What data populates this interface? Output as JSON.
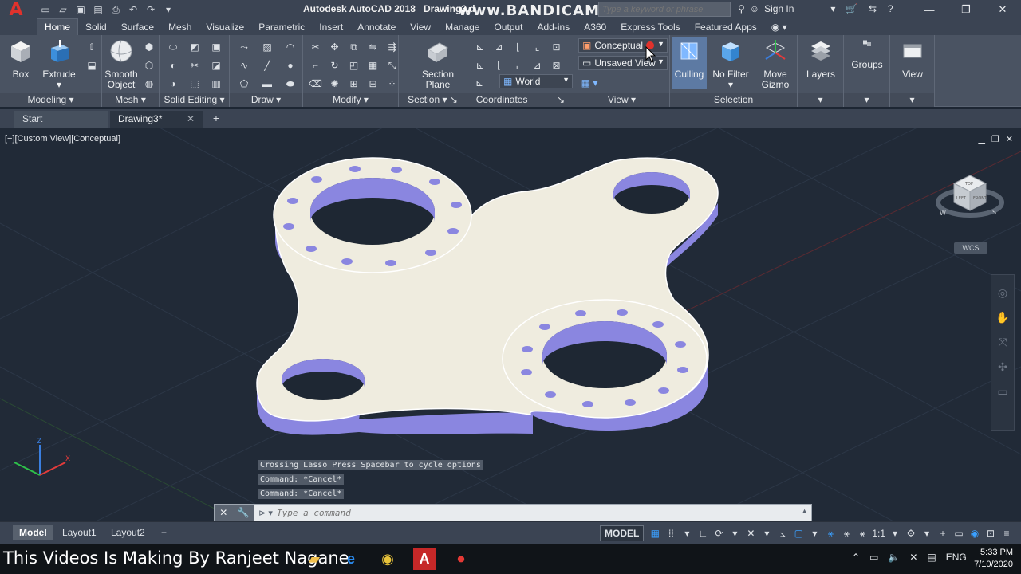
{
  "titlebar": {
    "app_title": "Autodesk AutoCAD 2018",
    "drawing_title": "Drawing3.d",
    "watermark": "www.BANDICAM.com",
    "search_placeholder": "Type a keyword or phrase",
    "sign_in": "Sign In"
  },
  "ribbon_tabs": [
    "Home",
    "Solid",
    "Surface",
    "Mesh",
    "Visualize",
    "Parametric",
    "Insert",
    "Annotate",
    "View",
    "Manage",
    "Output",
    "Add-ins",
    "A360",
    "Express Tools",
    "Featured Apps"
  ],
  "ribbon": {
    "modeling": {
      "title": "Modeling",
      "box": "Box",
      "extrude": "Extrude"
    },
    "mesh": {
      "title": "Mesh",
      "smooth_object": "Smooth Object"
    },
    "solid_editing": {
      "title": "Solid Editing"
    },
    "draw": {
      "title": "Draw"
    },
    "modify": {
      "title": "Modify"
    },
    "section": {
      "title": "Section",
      "section_plane": "Section Plane"
    },
    "coordinates": {
      "title": "Coordinates",
      "ucs": "World"
    },
    "view": {
      "title": "View",
      "visual_style": "Conceptual",
      "named_view": "Unsaved View"
    },
    "selection": {
      "title": "Selection",
      "culling": "Culling",
      "no_filter": "No Filter",
      "move_gizmo": "Move Gizmo"
    },
    "layers": "Layers",
    "groups": "Groups",
    "view_btn": "View"
  },
  "doc_tabs": {
    "start": "Start",
    "active": "Drawing3*"
  },
  "viewport": {
    "label": "[−][Custom View][Conceptual]",
    "wcs": "WCS",
    "cube_top": "TOP",
    "cube_left": "LEFT",
    "cube_front": "FRONT",
    "compass_w": "W",
    "compass_s": "S"
  },
  "command": {
    "history": [
      "Crossing Lasso  Press Spacebar to cycle options",
      "Command: *Cancel*",
      "Command: *Cancel*"
    ],
    "placeholder": "Type a command"
  },
  "status": {
    "layouts": [
      "Model",
      "Layout1",
      "Layout2"
    ],
    "model_btn": "MODEL",
    "scale": "1:1"
  },
  "taskbar": {
    "overlay": "This Videos Is Making By Ranjeet Nagane",
    "lang": "ENG",
    "time": "5:33 PM",
    "date": "7/10/2020"
  },
  "colors": {
    "accent_blue": "#3aa0ff",
    "part_face": "#efecdf",
    "part_side": "#8a86e0"
  }
}
